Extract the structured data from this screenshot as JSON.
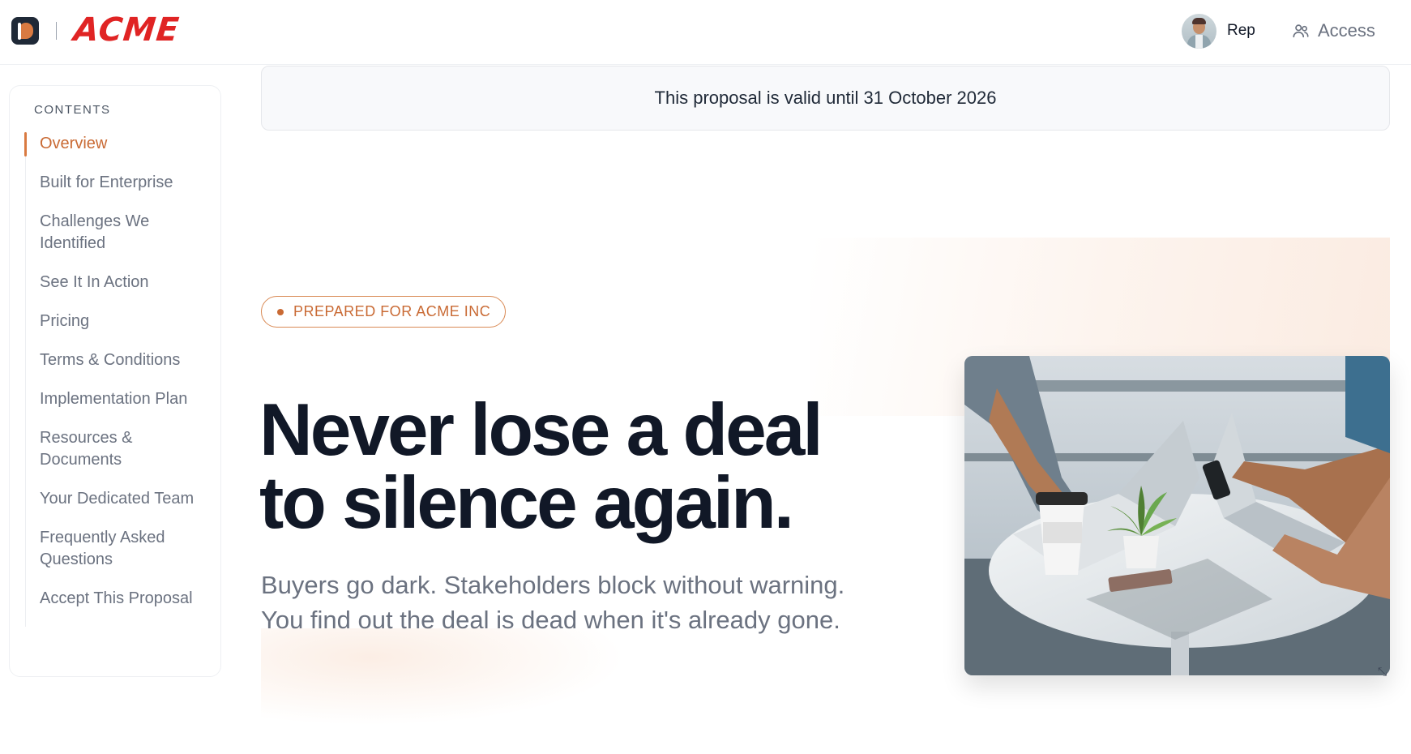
{
  "header": {
    "brand": "ACME",
    "rep_name": "Rep",
    "access_label": "Access"
  },
  "sidebar": {
    "title": "CONTENTS",
    "items": [
      {
        "label": "Overview",
        "active": true
      },
      {
        "label": "Built for Enterprise"
      },
      {
        "label": "Challenges We Identified"
      },
      {
        "label": "See It In Action"
      },
      {
        "label": "Pricing"
      },
      {
        "label": "Terms & Conditions"
      },
      {
        "label": "Implementation Plan"
      },
      {
        "label": "Resources & Documents"
      },
      {
        "label": "Your Dedicated Team"
      },
      {
        "label": "Frequently Asked Questions"
      },
      {
        "label": "Accept This Proposal"
      }
    ]
  },
  "banner": {
    "text": "This proposal is valid until 31 October 2026"
  },
  "hero": {
    "badge": "PREPARED FOR ACME INC",
    "headline_line1": "Never lose a deal",
    "headline_line2": "to silence again.",
    "subtext_line1": "Buyers go dark. Stakeholders block without warning.",
    "subtext_line2": "You find out the deal is dead when it's already gone."
  },
  "colors": {
    "accent": "#d97a41",
    "brand_red": "#e02424",
    "heading": "#111827",
    "muted": "#6b7280"
  }
}
